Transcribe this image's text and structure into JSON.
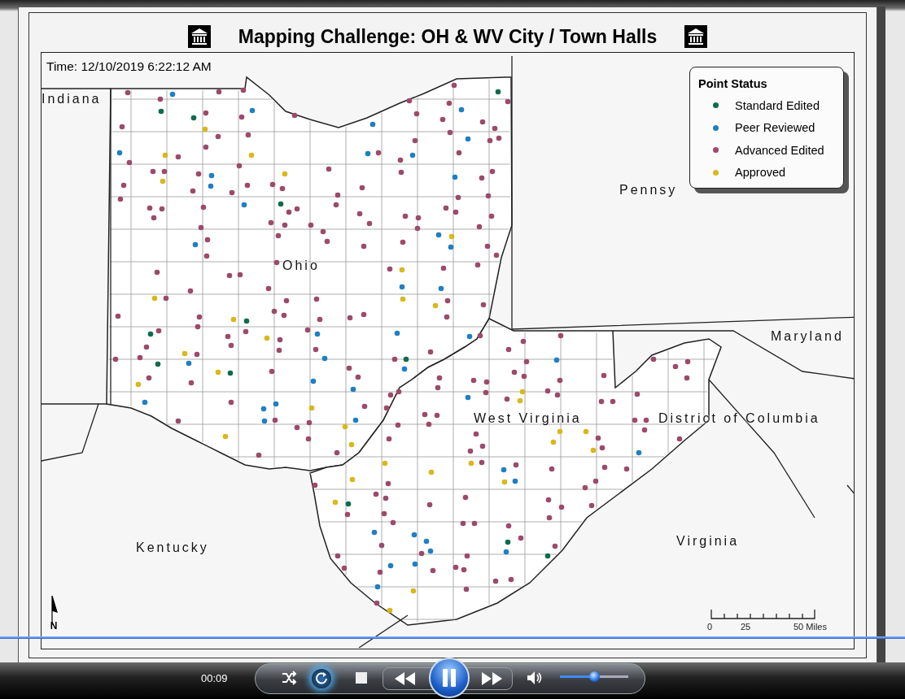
{
  "layout": {
    "title": "Mapping Challenge: OH & WV City / Town Halls",
    "time": "Time: 12/10/2019 6:22:12 AM",
    "legend": {
      "title": "Point Status",
      "items": [
        {
          "label": "Standard Edited",
          "color": "#0f6b4f"
        },
        {
          "label": "Peer Reviewed",
          "color": "#1f7fc4"
        },
        {
          "label": "Advanced Edited",
          "color": "#9c4a6c"
        },
        {
          "label": "Approved",
          "color": "#d8b81c"
        }
      ]
    },
    "state_labels": [
      "Indiana",
      "Pennsy",
      "Ohio",
      "Maryland",
      "West Virginia",
      "District of Columbia",
      "Kentucky",
      "Virginia"
    ],
    "north_label": "N",
    "scale_labels": [
      "0",
      "25",
      "50 Miles"
    ]
  },
  "player": {
    "time": "00:09",
    "repeat_on": true,
    "playing": true,
    "volume": {
      "level": 0.5
    }
  }
}
